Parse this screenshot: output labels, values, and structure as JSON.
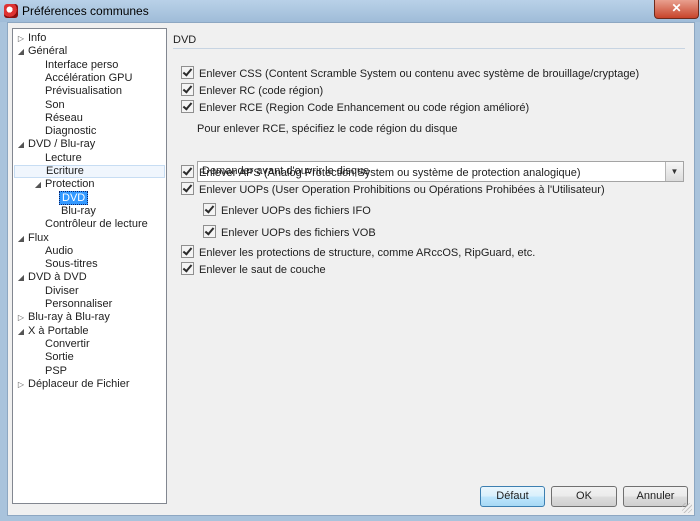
{
  "window": {
    "title": "Préférences communes",
    "close_glyph": "✕"
  },
  "tree": [
    {
      "label": "Info",
      "level": 0,
      "arrow": "collapsed"
    },
    {
      "label": "Général",
      "level": 0,
      "arrow": "expanded"
    },
    {
      "label": "Interface perso",
      "level": 1,
      "arrow": "none"
    },
    {
      "label": "Accélération GPU",
      "level": 1,
      "arrow": "none"
    },
    {
      "label": "Prévisualisation",
      "level": 1,
      "arrow": "none"
    },
    {
      "label": "Son",
      "level": 1,
      "arrow": "none"
    },
    {
      "label": "Réseau",
      "level": 1,
      "arrow": "none"
    },
    {
      "label": "Diagnostic",
      "level": 1,
      "arrow": "none"
    },
    {
      "label": "DVD / Blu-ray",
      "level": 0,
      "arrow": "expanded"
    },
    {
      "label": "Lecture",
      "level": 1,
      "arrow": "none"
    },
    {
      "label": "Ecriture",
      "level": 1,
      "arrow": "none",
      "hover": true
    },
    {
      "label": "Protection",
      "level": 1,
      "arrow": "expanded"
    },
    {
      "label": "DVD",
      "level": 2,
      "arrow": "none",
      "selected": true
    },
    {
      "label": "Blu-ray",
      "level": 2,
      "arrow": "none"
    },
    {
      "label": "Contrôleur de lecture",
      "level": 1,
      "arrow": "none"
    },
    {
      "label": "Flux",
      "level": 0,
      "arrow": "expanded"
    },
    {
      "label": "Audio",
      "level": 1,
      "arrow": "none"
    },
    {
      "label": "Sous-titres",
      "level": 1,
      "arrow": "none"
    },
    {
      "label": "DVD à DVD",
      "level": 0,
      "arrow": "expanded"
    },
    {
      "label": "Diviser",
      "level": 1,
      "arrow": "none"
    },
    {
      "label": "Personnaliser",
      "level": 1,
      "arrow": "none"
    },
    {
      "label": "Blu-ray à Blu-ray",
      "level": 0,
      "arrow": "collapsed"
    },
    {
      "label": "X à Portable",
      "level": 0,
      "arrow": "expanded"
    },
    {
      "label": "Convertir",
      "level": 1,
      "arrow": "none"
    },
    {
      "label": "Sortie",
      "level": 1,
      "arrow": "none"
    },
    {
      "label": "PSP",
      "level": 1,
      "arrow": "none"
    },
    {
      "label": "Déplaceur de Fichier",
      "level": 0,
      "arrow": "collapsed"
    }
  ],
  "panel": {
    "title": "DVD",
    "cb_css": "Enlever CSS (Content Scramble System ou contenu avec système de brouillage/cryptage)",
    "cb_rc": "Enlever RC (code région)",
    "cb_rce": "Enlever RCE (Region Code Enhancement ou code région amélioré)",
    "rce_prompt": "Pour enlever RCE, spécifiez le code région du disque",
    "rce_select_value": "Demander avant d'ouvrir le disque",
    "cb_aps": "Enlever APS (Analog Protection System ou système de protection analogique)",
    "cb_uops": "Enlever UOPs (User Operation Prohibitions ou Opérations Prohibées à l'Utilisateur)",
    "cb_uops_ifo": "Enlever UOPs des fichiers IFO",
    "cb_uops_vob": "Enlever UOPs des fichiers VOB",
    "cb_structure": "Enlever les protections de structure, comme ARccOS, RipGuard, etc.",
    "cb_layer": "Enlever le saut de couche"
  },
  "buttons": {
    "default_label": "Défaut",
    "ok_label": "OK",
    "cancel_label": "Annuler"
  }
}
